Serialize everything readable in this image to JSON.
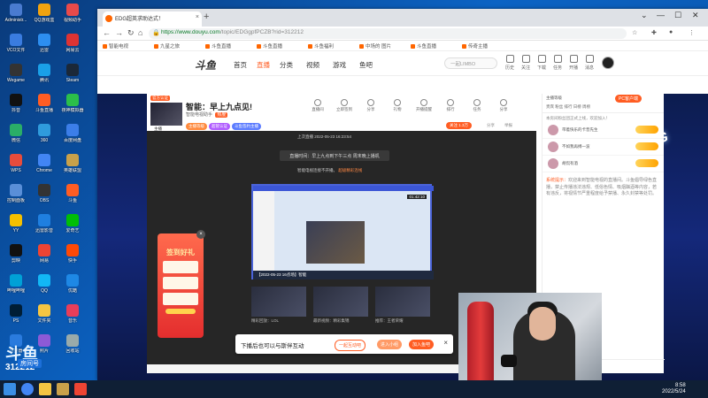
{
  "desktop": {
    "icons": [
      {
        "label": "Administr...",
        "color": "#4a7bd0"
      },
      {
        "label": "QQ游戏盒",
        "color": "#f2a30f"
      },
      {
        "label": "视频助手",
        "color": "#e84a4a"
      },
      {
        "label": "VCO文件",
        "color": "#3a7ce0"
      },
      {
        "label": "迅雷",
        "color": "#2d8ef0"
      },
      {
        "label": "网易云",
        "color": "#d33"
      },
      {
        "label": "Wegame",
        "color": "#333"
      },
      {
        "label": "腾讯",
        "color": "#1aa0e8"
      },
      {
        "label": "Steam",
        "color": "#1b2838"
      },
      {
        "label": "抖音",
        "color": "#111"
      },
      {
        "label": "斗鱼直播",
        "color": "#ff5d23"
      },
      {
        "label": "夜神模拟器",
        "color": "#2bbf4a"
      },
      {
        "label": "微信",
        "color": "#2aae67"
      },
      {
        "label": "360",
        "color": "#2f9bdc"
      },
      {
        "label": "百度网盘",
        "color": "#3c7ee8"
      },
      {
        "label": "WPS",
        "color": "#e74c3c"
      },
      {
        "label": "Chrome",
        "color": "#4285f4"
      },
      {
        "label": "英雄联盟",
        "color": "#c9a14a"
      },
      {
        "label": "控制面板",
        "color": "#5a8fd8"
      },
      {
        "label": "OBS",
        "color": "#333"
      },
      {
        "label": "斗鱼",
        "color": "#ff5d23"
      },
      {
        "label": "YY",
        "color": "#f5c000"
      },
      {
        "label": "迅雷影音",
        "color": "#1f7fe0"
      },
      {
        "label": "爱奇艺",
        "color": "#00be06"
      },
      {
        "label": "剪映",
        "color": "#111"
      },
      {
        "label": "网易",
        "color": "#e43"
      },
      {
        "label": "快手",
        "color": "#ff4906"
      },
      {
        "label": "哔哩哔哩",
        "color": "#00a1d6"
      },
      {
        "label": "QQ",
        "color": "#12b7f5"
      },
      {
        "label": "优酷",
        "color": "#1e88e5"
      },
      {
        "label": "PS",
        "color": "#001e36"
      },
      {
        "label": "文件夹",
        "color": "#f5c542"
      },
      {
        "label": "音乐",
        "color": "#e83e5a"
      },
      {
        "label": "浏览器",
        "color": "#2a7bde"
      },
      {
        "label": "照片",
        "color": "#8c5ad6"
      },
      {
        "label": "回收站",
        "color": "#9aa"
      }
    ],
    "watermark_brand": "斗鱼",
    "watermark_tag": "房间号",
    "watermark_number": "312212"
  },
  "browser": {
    "tab_title": "EDG超英求助达式！",
    "tab_close": "×",
    "new_tab": "+",
    "url_host": "https://www.douyu.com",
    "url_path": "/topic/EDGgpfPCZB?rid=312212",
    "bookmarks": [
      "智能电视",
      "九星之旅",
      "斗鱼直播",
      "斗鱼直播",
      "斗鱼福利",
      "中场的 图片",
      "斗鱼直播",
      "传奇主播"
    ]
  },
  "douyu_header": {
    "logo": "斗鱼",
    "nav": [
      "首页",
      "直播",
      "分类",
      "视频",
      "游戏",
      "鱼吧"
    ],
    "search_placeholder": "一起LIMBO",
    "icons": [
      "历史",
      "关注",
      "下载",
      "任务",
      "开播",
      "消息"
    ]
  },
  "room": {
    "badge": "官方认证",
    "title": "智能：早上九点见!",
    "anchor": "主播",
    "line2": "智能电视助手",
    "hot_label": "热度",
    "tags": [
      {
        "t": "主播等级",
        "c": "#ff8a3d"
      },
      {
        "t": "超管认证",
        "c": "#b05cff"
      },
      {
        "t": "斗鱼签约主播",
        "c": "#5c7cff"
      }
    ],
    "icons": [
      "直播间",
      "立即签到",
      "分享",
      "礼物",
      "开播提醒",
      "排行",
      "任务",
      "分享"
    ],
    "follow": "关注 1.3万",
    "share": "分享",
    "report": "举报"
  },
  "video": {
    "live_time": "上次直播 2022-05-23 16:23:54",
    "notice": "直播时间：早上九点到下午三点 周末晚上播机",
    "notice2_pre": "智能电视连接不开播。",
    "notice2_hl": "超级精彩连线",
    "screen_time": "01:42:10",
    "screen_footer": "【2022-05-23 16点场】智能",
    "thumb_caps": [
      "精彩回放：LOL",
      "最新视频：精彩集锦",
      "推荐：王者荣耀"
    ],
    "gift_title": "签到好礼",
    "gift_close": "×"
  },
  "promo": {
    "text": "下播后也可以与斯伴互动",
    "btn1": "一起互动吧",
    "btn2": "进入小组",
    "btn3": "加入鱼吧",
    "close": "×"
  },
  "chat": {
    "top_text": "主播等级",
    "pc_btn": "PC客户端",
    "tabs": "贵宾 粉丝 排行 日榜 周榜",
    "note": "本房间粉丝团正式上线，欢迎加入！",
    "ranks": [
      "带着快乐的卡普先生",
      "不如我再搏一波",
      "胡侃有酒"
    ],
    "sys_label": "系统提示：",
    "sys_text": "欢迎来到智能电视的直播间。斗鱼倡导绿色直播，禁止传播违法违规、低俗色情、吸烟酗酒等内容，若有违反，将视情节严重程度给予禁播、永久封禁等处罚。"
  },
  "taskbar": {
    "time": "8:58",
    "date": "2022/5/24"
  },
  "colors": {
    "accent": "#ff5d23",
    "desktop_bg": "#0b63c4"
  }
}
